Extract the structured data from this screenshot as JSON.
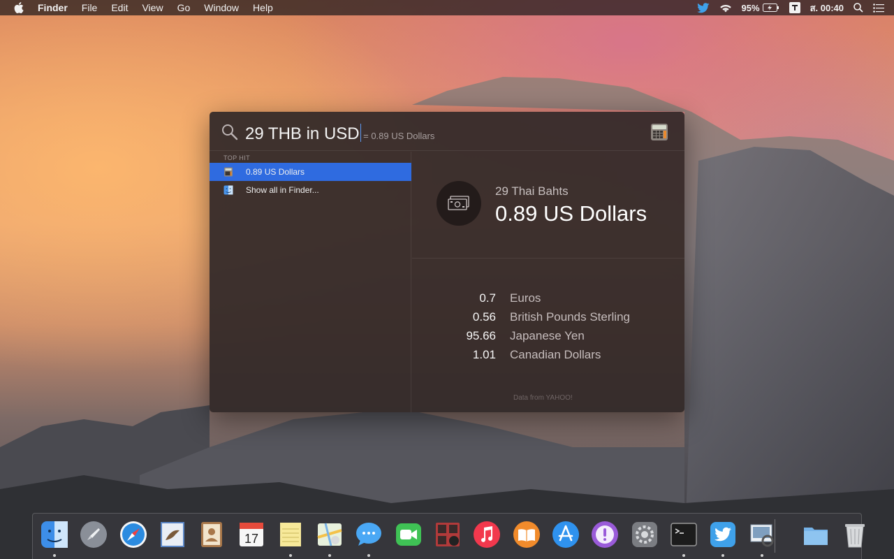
{
  "menubar": {
    "app_name": "Finder",
    "menus": [
      "File",
      "Edit",
      "View",
      "Go",
      "Window",
      "Help"
    ],
    "battery": "95%",
    "clock": "ส. 00:40"
  },
  "spotlight": {
    "query": "29 THB in USD",
    "inline_hint": "= 0.89 US Dollars",
    "section_label": "TOP HIT",
    "results": [
      {
        "label": "0.89 US Dollars",
        "icon": "calculator-icon",
        "selected": true
      },
      {
        "label": "Show all in Finder...",
        "icon": "finder-icon",
        "selected": false
      }
    ],
    "preview": {
      "source_amount": "29 Thai Bahts",
      "converted": "0.89 US Dollars",
      "conversions": [
        {
          "value": "0.7",
          "unit": "Euros"
        },
        {
          "value": "0.56",
          "unit": "British Pounds Sterling"
        },
        {
          "value": "95.66",
          "unit": "Japanese Yen"
        },
        {
          "value": "1.01",
          "unit": "Canadian Dollars"
        }
      ],
      "source_credit": "Data from YAHOO!"
    }
  },
  "dock": {
    "apps": [
      {
        "name": "finder",
        "color": "#3d8ee8",
        "running": true
      },
      {
        "name": "launchpad",
        "color": "#8a8f98",
        "running": false
      },
      {
        "name": "safari",
        "color": "#2b8be0",
        "running": false
      },
      {
        "name": "mail",
        "color": "#5a86c6",
        "running": false
      },
      {
        "name": "contacts",
        "color": "#a8774a",
        "running": false
      },
      {
        "name": "calendar",
        "color": "#f4f4f4",
        "running": false
      },
      {
        "name": "notes",
        "color": "#f2e289",
        "running": true
      },
      {
        "name": "maps",
        "color": "#7fc16e",
        "running": true
      },
      {
        "name": "messages",
        "color": "#4aa8f5",
        "running": true
      },
      {
        "name": "facetime",
        "color": "#3fc255",
        "running": false
      },
      {
        "name": "photo-booth",
        "color": "#b23a3a",
        "running": false
      },
      {
        "name": "itunes",
        "color": "#f2384d",
        "running": false
      },
      {
        "name": "ibooks",
        "color": "#f18b2b",
        "running": false
      },
      {
        "name": "app-store",
        "color": "#2f92ee",
        "running": false
      },
      {
        "name": "podcasts",
        "color": "#9a5bd9",
        "running": false
      },
      {
        "name": "system-preferences",
        "color": "#7b7d82",
        "running": false
      },
      {
        "name": "terminal",
        "color": "#1c1c1c",
        "running": true
      },
      {
        "name": "twitter",
        "color": "#3fa1ea",
        "running": true
      },
      {
        "name": "preview",
        "color": "#8b9db2",
        "running": true
      },
      {
        "name": "applications-folder",
        "color": "#76b3e8",
        "running": false
      },
      {
        "name": "trash",
        "color": "#d8dadc",
        "running": false
      }
    ],
    "calendar_day": "17"
  }
}
